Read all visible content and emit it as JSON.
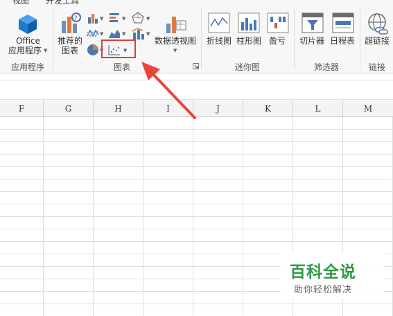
{
  "tabs": {
    "view": "视图",
    "developer": "开发工具"
  },
  "ribbon": {
    "apps_group": {
      "office_label_line1": "Office",
      "office_label_line2": "应用程序",
      "group_label": "应用程序"
    },
    "charts_group": {
      "recommended_line1": "推荐的",
      "recommended_line2": "图表",
      "pivot_chart": "数据透视图",
      "group_label": "图表"
    },
    "sparklines_group": {
      "line": "折线图",
      "column": "柱形图",
      "win_loss": "盈亏",
      "group_label": "迷你图"
    },
    "filters_group": {
      "slicer": "切片器",
      "timeline": "日程表",
      "group_label": "筛选器"
    },
    "links_group": {
      "hyperlink": "超链接",
      "group_label": "链接"
    }
  },
  "grid": {
    "columns": [
      "F",
      "G",
      "H",
      "I",
      "J",
      "K",
      "L",
      "M"
    ]
  },
  "watermark": {
    "title": "百科全说",
    "subtitle": "助你轻松解决"
  },
  "colors": {
    "highlight_red": "#e03c3c",
    "arrow_red": "#e8463c",
    "watermark_green": "#2e9a44",
    "office_blue": "#1a7bd1"
  },
  "icons": {
    "office": "office-cube-icon",
    "recommended": "recommended-charts-icon",
    "scatter": "scatter-chart-icon",
    "pivot_chart": "pivot-chart-icon",
    "hyperlink": "hyperlink-globe-icon"
  }
}
